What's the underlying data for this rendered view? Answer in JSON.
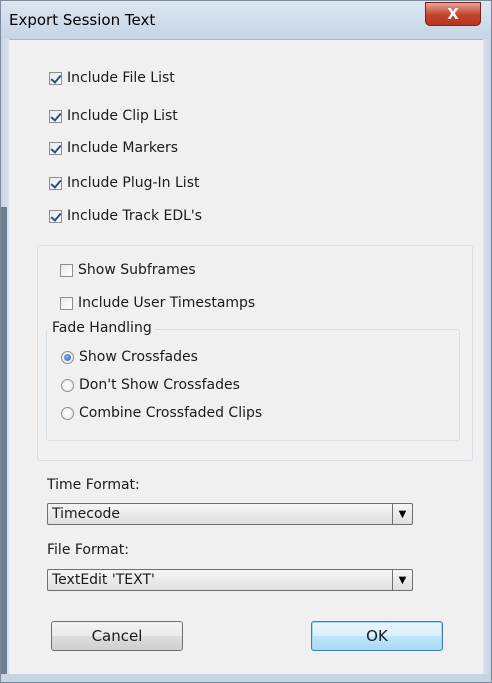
{
  "window": {
    "title": "Export Session Text",
    "close_glyph": "X"
  },
  "include_options": [
    {
      "label": "Include File List",
      "checked": true
    },
    {
      "label": "Include Clip List",
      "checked": true
    },
    {
      "label": "Include Markers",
      "checked": true
    },
    {
      "label": "Include Plug-In List",
      "checked": true
    },
    {
      "label": "Include Track EDL's",
      "checked": true
    }
  ],
  "edl_options": {
    "show_subframes": {
      "label": "Show Subframes",
      "checked": false
    },
    "include_user_timestamps": {
      "label": "Include User Timestamps",
      "checked": false
    },
    "fade_handling": {
      "legend": "Fade Handling",
      "options": [
        {
          "label": "Show Crossfades",
          "selected": true
        },
        {
          "label": "Don't Show Crossfades",
          "selected": false
        },
        {
          "label": "Combine Crossfaded Clips",
          "selected": false
        }
      ]
    }
  },
  "time_format": {
    "label": "Time Format:",
    "value": "Timecode"
  },
  "file_format": {
    "label": "File Format:",
    "value": "TextEdit 'TEXT'"
  },
  "buttons": {
    "cancel": "Cancel",
    "ok": "OK"
  },
  "colors": {
    "accent": "#3c7fb1",
    "close": "#c4412b"
  }
}
